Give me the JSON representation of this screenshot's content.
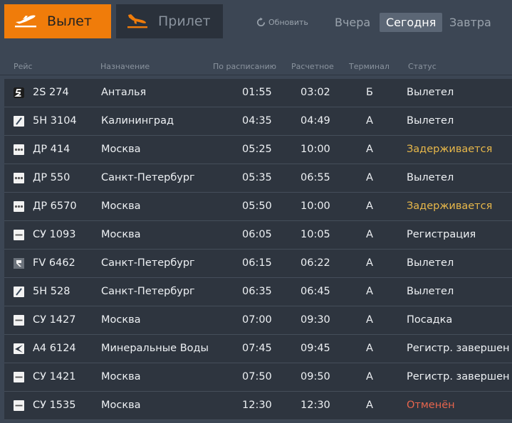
{
  "tabs": {
    "departures": "Вылет",
    "arrivals": "Прилет"
  },
  "refresh_label": "Обновить",
  "days": {
    "yesterday": "Вчера",
    "today": "Сегодня",
    "tomorrow": "Завтра"
  },
  "columns": {
    "flight": "Рейс",
    "destination": "Назначение",
    "scheduled": "По расписанию",
    "estimated": "Расчетное",
    "terminal": "Терминал",
    "status": "Статус"
  },
  "colors": {
    "accent": "#f07c0a",
    "background": "#3c4654",
    "row": "#2e353f",
    "delayed": "#e8b84a",
    "cancelled": "#e8654d"
  },
  "flights": [
    {
      "logo": "airline-2s-logo-icon",
      "flight": "2S 274",
      "destination": "Анталья",
      "scheduled": "01:55",
      "estimated": "03:02",
      "terminal": "Б",
      "status": "Вылетел",
      "status_type": "normal"
    },
    {
      "logo": "airline-5n-logo-icon",
      "flight": "5Н 3104",
      "destination": "Калининград",
      "scheduled": "04:35",
      "estimated": "04:49",
      "terminal": "А",
      "status": "Вылетел",
      "status_type": "normal"
    },
    {
      "logo": "airline-dp-logo-icon",
      "flight": "ДР 414",
      "destination": "Москва",
      "scheduled": "05:25",
      "estimated": "10:00",
      "terminal": "А",
      "status": "Задерживается",
      "status_type": "delayed"
    },
    {
      "logo": "airline-dp-logo-icon",
      "flight": "ДР 550",
      "destination": "Санкт-Петербург",
      "scheduled": "05:35",
      "estimated": "06:55",
      "terminal": "А",
      "status": "Вылетел",
      "status_type": "normal"
    },
    {
      "logo": "airline-dp-logo-icon",
      "flight": "ДР 6570",
      "destination": "Москва",
      "scheduled": "05:50",
      "estimated": "10:00",
      "terminal": "А",
      "status": "Задерживается",
      "status_type": "delayed"
    },
    {
      "logo": "airline-su-logo-icon",
      "flight": "СУ 1093",
      "destination": "Москва",
      "scheduled": "06:05",
      "estimated": "10:05",
      "terminal": "А",
      "status": "Регистрация",
      "status_type": "normal"
    },
    {
      "logo": "airline-fv-logo-icon",
      "flight": "FV 6462",
      "destination": "Санкт-Петербург",
      "scheduled": "06:15",
      "estimated": "06:22",
      "terminal": "А",
      "status": "Вылетел",
      "status_type": "normal"
    },
    {
      "logo": "airline-5n-logo-icon",
      "flight": "5Н 528",
      "destination": "Санкт-Петербург",
      "scheduled": "06:35",
      "estimated": "06:45",
      "terminal": "А",
      "status": "Вылетел",
      "status_type": "normal"
    },
    {
      "logo": "airline-su-logo-icon",
      "flight": "СУ 1427",
      "destination": "Москва",
      "scheduled": "07:00",
      "estimated": "09:30",
      "terminal": "А",
      "status": "Посадка",
      "status_type": "normal"
    },
    {
      "logo": "airline-a4-logo-icon",
      "flight": "А4 6124",
      "destination": "Минеральные Воды",
      "scheduled": "07:45",
      "estimated": "09:45",
      "terminal": "А",
      "status": "Регистр. завершен",
      "status_type": "normal"
    },
    {
      "logo": "airline-su-logo-icon",
      "flight": "СУ 1421",
      "destination": "Москва",
      "scheduled": "07:50",
      "estimated": "09:50",
      "terminal": "А",
      "status": "Регистр. завершен",
      "status_type": "normal"
    },
    {
      "logo": "airline-su-logo-icon",
      "flight": "СУ 1535",
      "destination": "Москва",
      "scheduled": "12:30",
      "estimated": "12:30",
      "terminal": "А",
      "status": "Отменён",
      "status_type": "cancelled"
    }
  ]
}
